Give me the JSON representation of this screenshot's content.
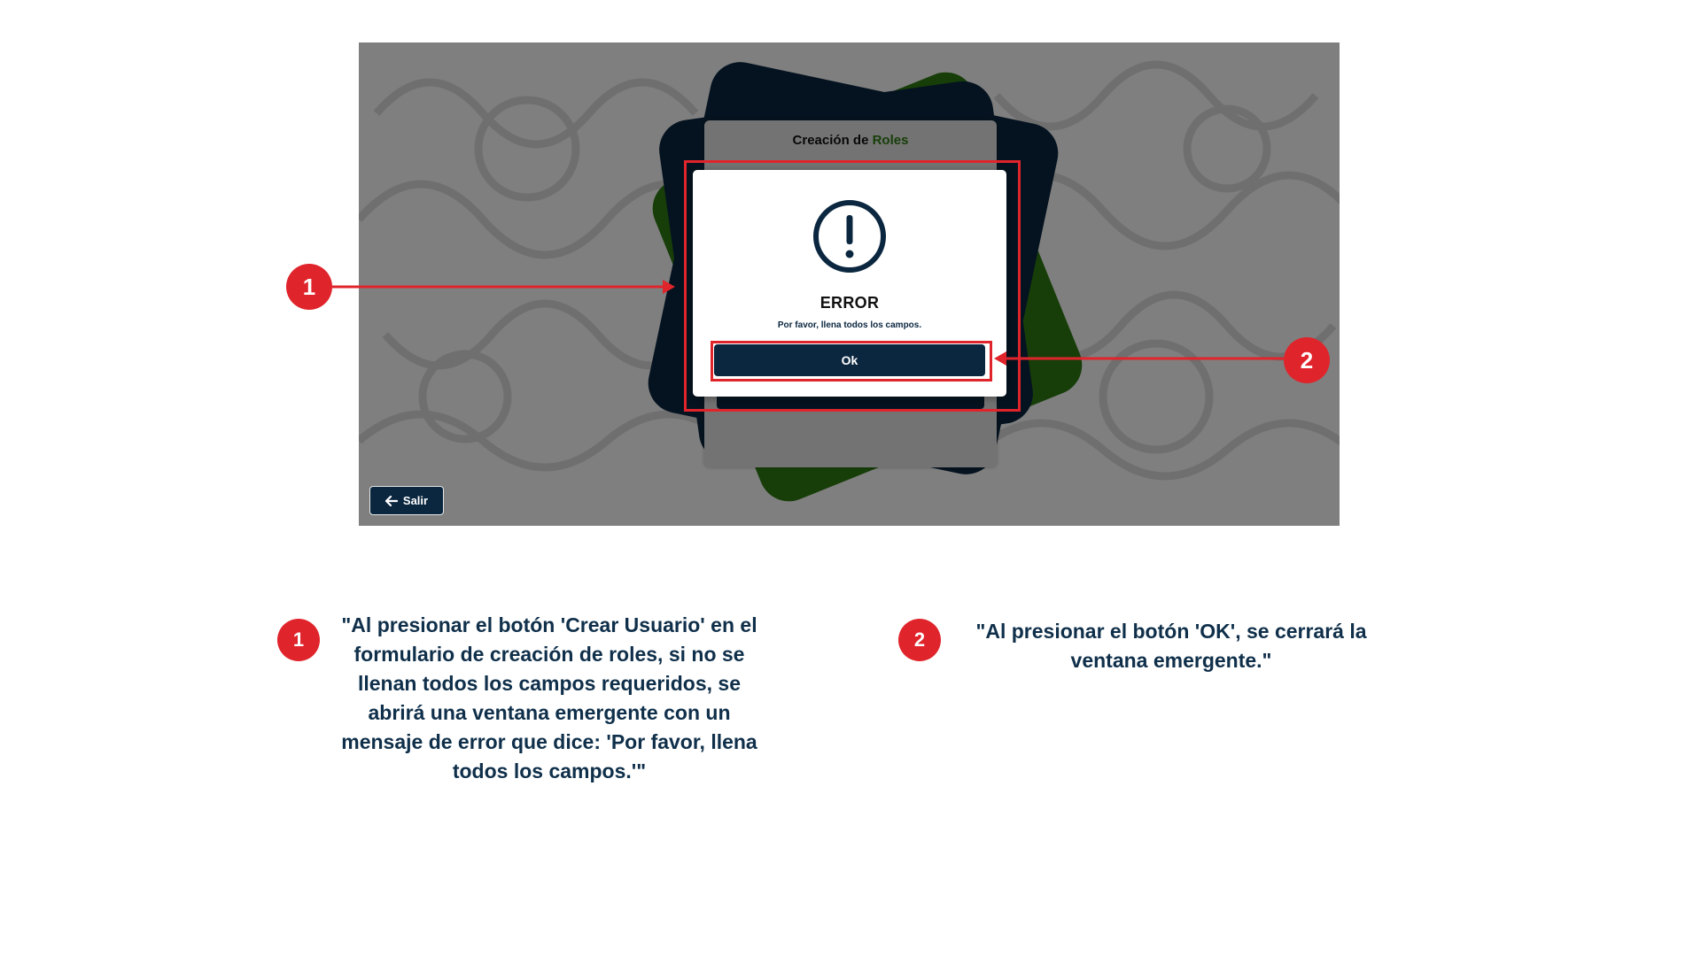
{
  "screenshot": {
    "form_title_prefix": "Creación de",
    "form_title_accent": "Roles",
    "exit_button_label": "Salir",
    "exit_icon": "arrow-left-icon",
    "modal": {
      "icon": "exclamation-circle-icon",
      "title": "ERROR",
      "message": "Por favor, llena todos los campos.",
      "ok_label": "Ok"
    }
  },
  "annotations": {
    "badge_1": "1",
    "badge_2": "2",
    "color": "#e0242b"
  },
  "descriptions": [
    {
      "number": "1",
      "text": "\"Al presionar el botón 'Crear Usuario' en el formulario de creación de roles, si no se llenan todos los campos requeridos, se abrirá una ventana emergente con un mensaje de error que dice: 'Por favor, llena todos los campos.'\""
    },
    {
      "number": "2",
      "text": "\"Al presionar el botón 'OK', se cerrará la ventana emergente.\""
    }
  ],
  "colors": {
    "navy": "#0b2740",
    "green": "#2e7d13",
    "red": "#e0242b",
    "text_navy": "#0f2f4a"
  }
}
